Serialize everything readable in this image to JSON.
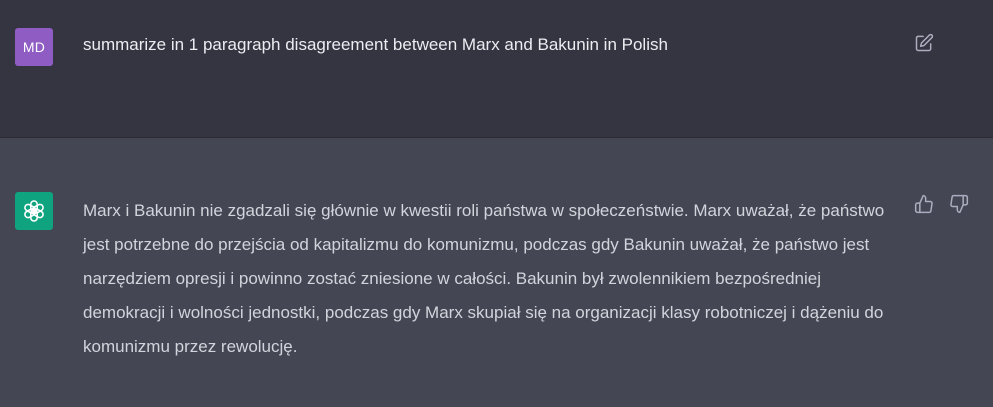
{
  "user_message": {
    "avatar_initials": "MD",
    "avatar_color": "#8e5cc2",
    "text": "summarize in 1 paragraph disagreement between Marx and Bakunin in Polish",
    "edit_icon": "edit-icon"
  },
  "assistant_message": {
    "avatar_icon": "openai-logo-icon",
    "avatar_color": "#10a37f",
    "text": "Marx i Bakunin nie zgadzali się głównie w kwestii roli państwa w społeczeństwie. Marx uważał, że państwo jest potrzebne do przejścia od kapitalizmu do komunizmu, podczas gdy Bakunin uważał, że państwo jest narzędziem opresji i powinno zostać zniesione w całości. Bakunin był zwolennikiem bezpośredniej demokracji i wolności jednostki, podczas gdy Marx skupiał się na organizacji klasy robotniczej i dążeniu do komunizmu przez rewolucję.",
    "feedback_icons": [
      "thumbs-up-icon",
      "thumbs-down-icon"
    ]
  },
  "colors": {
    "user_row_bg": "#343541",
    "assistant_row_bg": "#444654",
    "text_primary": "#ececf1",
    "text_secondary": "#d1d5db",
    "icon_color": "#acacbe"
  }
}
